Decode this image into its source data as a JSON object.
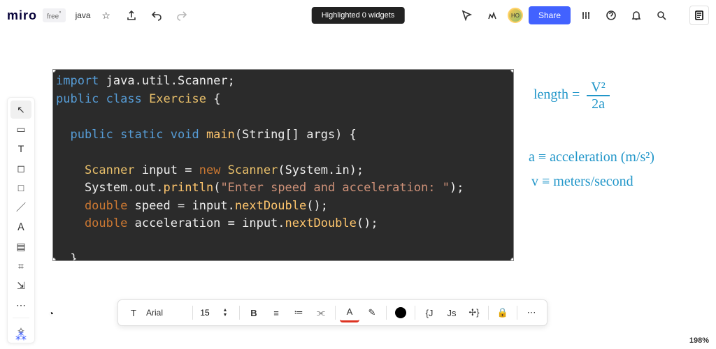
{
  "header": {
    "logo": "miro",
    "plan_badge": "free",
    "plan_star": "°",
    "board_name": "java",
    "notification": "Highlighted 0 widgets",
    "share_label": "Share",
    "avatar_initials": "HO"
  },
  "left_tools": [
    {
      "name": "cursor",
      "glyph": "↖"
    },
    {
      "name": "templates",
      "glyph": "▭"
    },
    {
      "name": "text",
      "glyph": "T"
    },
    {
      "name": "sticky",
      "glyph": "◻"
    },
    {
      "name": "shape",
      "glyph": "□"
    },
    {
      "name": "line",
      "glyph": "／"
    },
    {
      "name": "pen",
      "glyph": "Ａ"
    },
    {
      "name": "comment",
      "glyph": "▤"
    },
    {
      "name": "frame",
      "glyph": "⌗"
    },
    {
      "name": "upload",
      "glyph": "⇲"
    },
    {
      "name": "more",
      "glyph": "⋯"
    }
  ],
  "apps_tool": {
    "name": "apps",
    "glyph": "✧"
  },
  "cursor2": {
    "glyph": "◔"
  },
  "code": {
    "l1a": "import",
    "l1b": " java.util.Scanner;",
    "l2a": "public class ",
    "l2b": "Exercise",
    "l2c": " {",
    "l3a": "  public static void ",
    "l3b": "main",
    "l3c": "(String[] args) {",
    "l4a": "    Scanner ",
    "l4b": "input = ",
    "l4c": "new ",
    "l4d": "Scanner",
    "l4e": "(System.in);",
    "l5a": "    System.out.",
    "l5b": "println",
    "l5c": "(",
    "l5d": "\"Enter speed and acceleration: \"",
    "l5e": ");",
    "l6a": "    double ",
    "l6b": "speed = input.",
    "l6c": "nextDouble",
    "l6d": "();",
    "l7a": "    double ",
    "l7b": "acceleration = input.",
    "l7c": "nextDouble",
    "l7d": "();",
    "l8": "  }",
    "l9": "}"
  },
  "handwriting": {
    "eq_lhs": "length  =",
    "eq_num": "V²",
    "eq_den": "2a",
    "line_a": "a ≡ acceleration (m/s²)",
    "line_v": "v ≡ meters/second"
  },
  "format_bar": {
    "font": "Arial",
    "size": "15",
    "items": {
      "type": "T",
      "bold": "B",
      "align": "≡",
      "list": "≔",
      "link": "⫘",
      "textcolor": "A",
      "highlight": "✎",
      "braces": "{J",
      "js": "Js",
      "jsx": "✢}",
      "lock": "🔒",
      "more": "⋯"
    }
  },
  "zoom": "198%"
}
